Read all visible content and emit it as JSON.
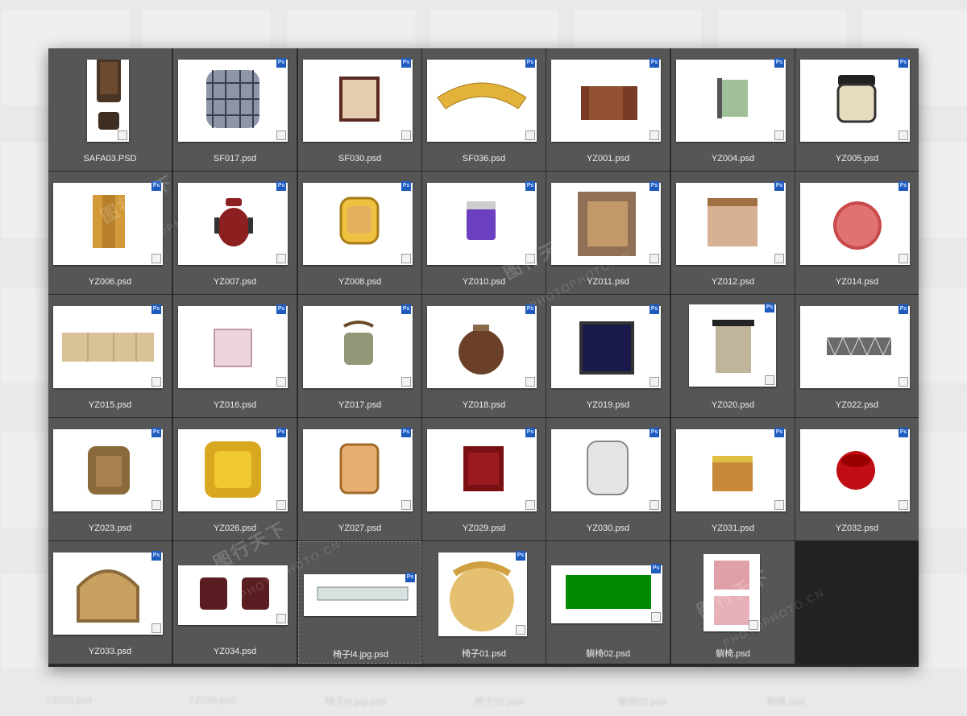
{
  "files": [
    {
      "name": "SAFA03.PSD",
      "icon": "sofa-set-icon"
    },
    {
      "name": "SF017.psd",
      "icon": "plaid-armchair-icon"
    },
    {
      "name": "SF030.psd",
      "icon": "square-seat-icon"
    },
    {
      "name": "SF036.psd",
      "icon": "curved-sofa-icon"
    },
    {
      "name": "YZ001.psd",
      "icon": "brown-chair-icon"
    },
    {
      "name": "YZ004.psd",
      "icon": "green-chair-icon"
    },
    {
      "name": "YZ005.psd",
      "icon": "cream-chair-icon"
    },
    {
      "name": "YZ006.psd",
      "icon": "wood-chair-icon"
    },
    {
      "name": "YZ007.psd",
      "icon": "red-office-chair-icon"
    },
    {
      "name": "YZ008.psd",
      "icon": "yellow-chair-icon"
    },
    {
      "name": "YZ010.psd",
      "icon": "purple-chair-icon"
    },
    {
      "name": "YZ011.psd",
      "icon": "tan-armchair-icon"
    },
    {
      "name": "YZ012.psd",
      "icon": "marble-chair-icon"
    },
    {
      "name": "YZ014.psd",
      "icon": "round-red-stool-icon"
    },
    {
      "name": "YZ015.psd",
      "icon": "quilted-bench-icon"
    },
    {
      "name": "YZ016.psd",
      "icon": "pattern-seat-icon"
    },
    {
      "name": "YZ017.psd",
      "icon": "spindle-chair-icon"
    },
    {
      "name": "YZ018.psd",
      "icon": "round-brown-chair-icon"
    },
    {
      "name": "YZ019.psd",
      "icon": "starry-chair-icon"
    },
    {
      "name": "YZ020.psd",
      "icon": "diamond-chair-icon"
    },
    {
      "name": "YZ022.psd",
      "icon": "zigzag-bench-icon"
    },
    {
      "name": "YZ023.psd",
      "icon": "leather-armchair-icon"
    },
    {
      "name": "YZ026.psd",
      "icon": "gold-armchair-icon"
    },
    {
      "name": "YZ027.psd",
      "icon": "peach-chair-icon"
    },
    {
      "name": "YZ029.psd",
      "icon": "maroon-chair-icon"
    },
    {
      "name": "YZ030.psd",
      "icon": "white-chair-icon"
    },
    {
      "name": "YZ031.psd",
      "icon": "cork-chair-icon"
    },
    {
      "name": "YZ032.psd",
      "icon": "red-pouf-icon"
    },
    {
      "name": "YZ033.psd",
      "icon": "tub-chair-icon"
    },
    {
      "name": "YZ034.psd",
      "icon": "twin-stools-icon"
    },
    {
      "name": "椅子l4.jpg.psd",
      "icon": "glass-bench-icon"
    },
    {
      "name": "椅子01.psd",
      "icon": "round-wicker-chair-icon"
    },
    {
      "name": "躺椅02.psd",
      "icon": "green-lounger-icon"
    },
    {
      "name": "躺椅.psd",
      "icon": "pink-lounger-icon"
    }
  ],
  "bottom_labels": [
    "YZ033.psd",
    "YZ034.psd",
    "椅子l4.jpg.psd",
    "椅子01.psd",
    "躺椅02.psd",
    "躺椅.psd"
  ],
  "badge_text": "Ps",
  "watermark": {
    "cn": "图行天下",
    "en": "PHOTOPHOTO.CN"
  },
  "colors": {
    "panel": "#2a2a2a",
    "cell": "#565656",
    "badge": "#1f5bbd",
    "label": "#ededed"
  }
}
